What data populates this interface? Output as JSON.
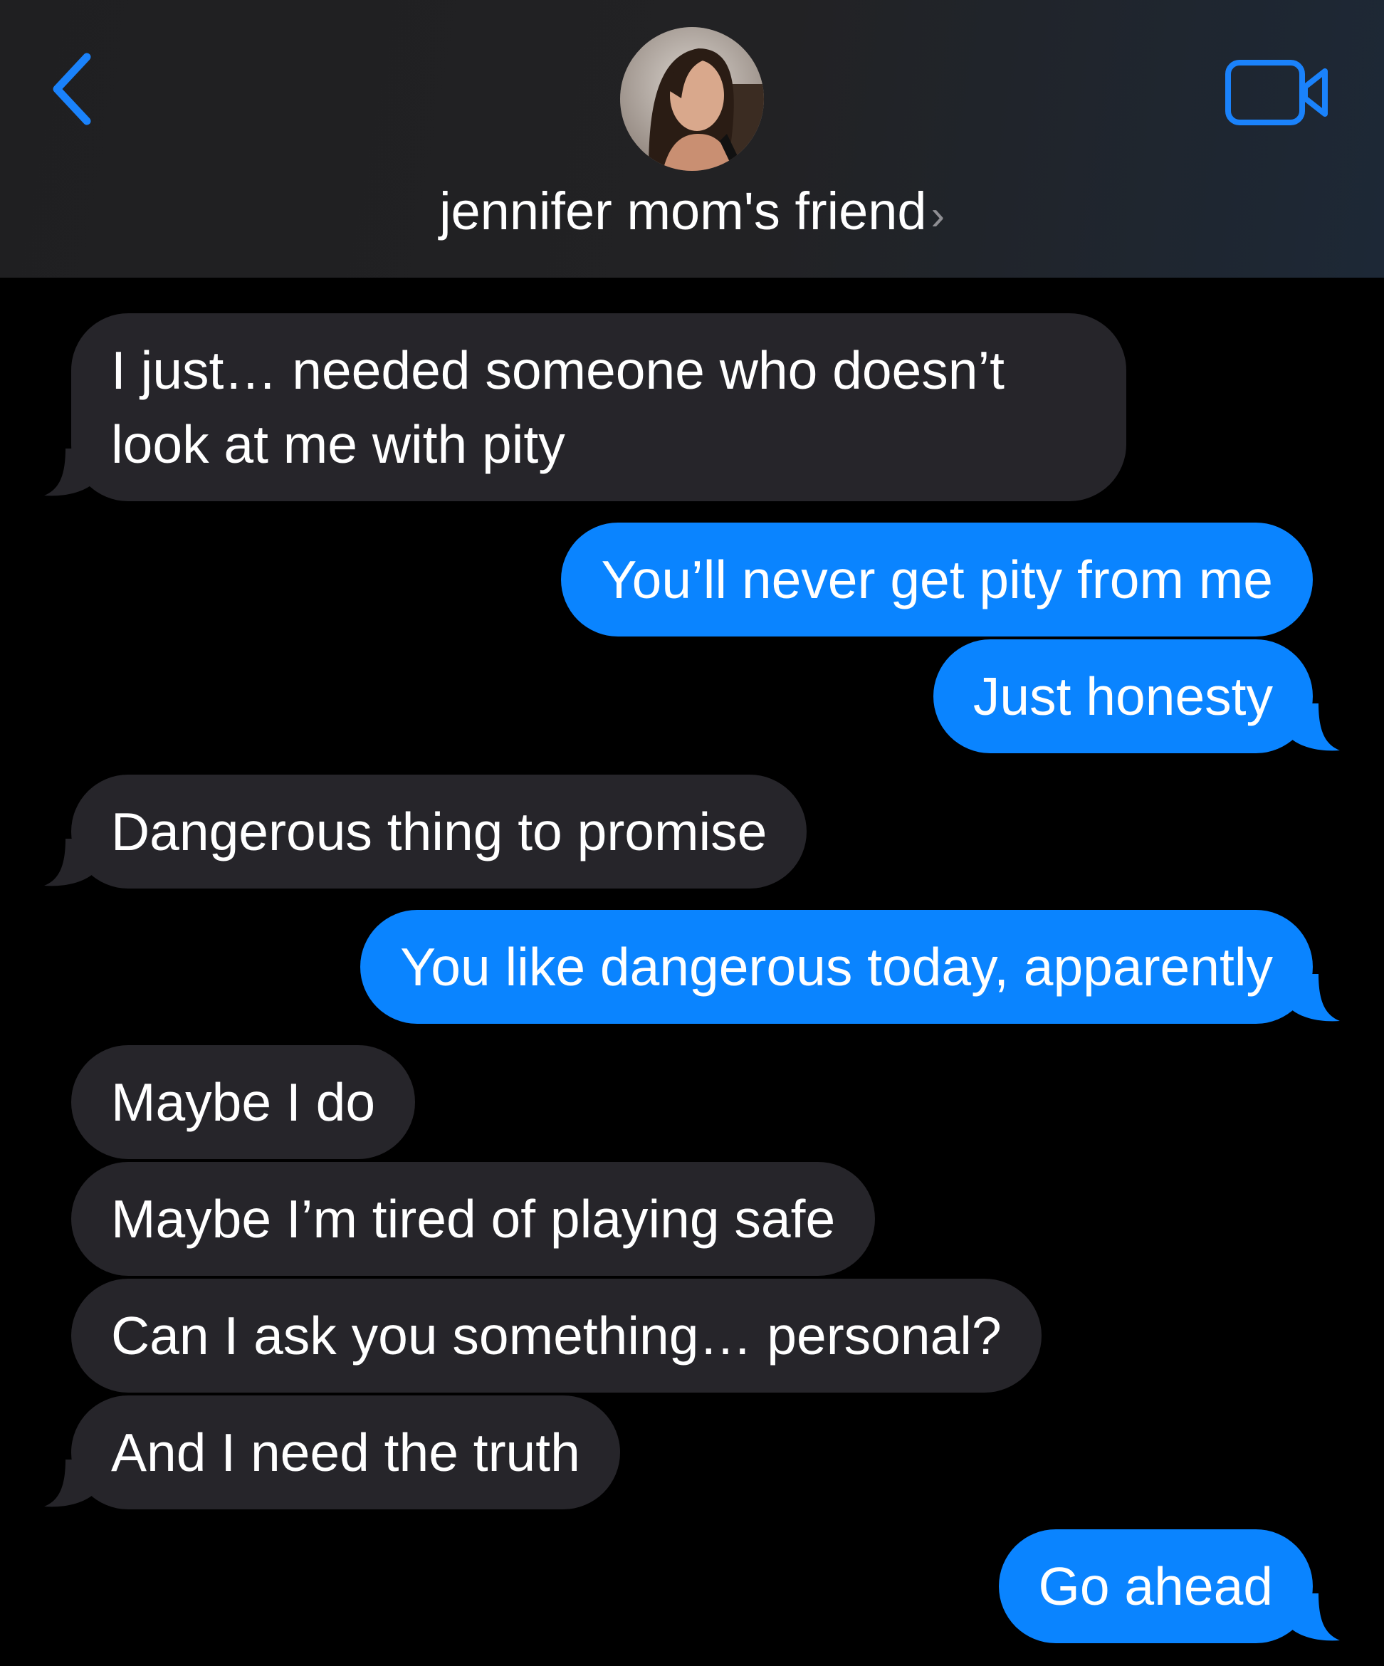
{
  "header": {
    "contact_name": "jennifer mom's friend",
    "name_chevron": "›",
    "back_icon": "chevron-left-icon",
    "video_icon": "video-camera-icon",
    "accent_color": "#0a84ff"
  },
  "messages": [
    {
      "from": "contact",
      "text": "I just… needed someone who doesn’t look at me with pity"
    },
    {
      "from": "me",
      "text": "You’ll never get pity from me"
    },
    {
      "from": "me",
      "text": "Just honesty"
    },
    {
      "from": "contact",
      "text": "Dangerous thing to promise"
    },
    {
      "from": "me",
      "text": "You like dangerous today, apparently"
    },
    {
      "from": "contact",
      "text": "Maybe I do"
    },
    {
      "from": "contact",
      "text": "Maybe I’m tired of playing safe"
    },
    {
      "from": "contact",
      "text": "Can I ask you something… personal?"
    },
    {
      "from": "contact",
      "text": "And I need the truth"
    },
    {
      "from": "me",
      "text": "Go ahead"
    }
  ],
  "colors": {
    "sent_bubble": "#0a84ff",
    "received_bubble": "#26252a",
    "background": "#000000"
  }
}
